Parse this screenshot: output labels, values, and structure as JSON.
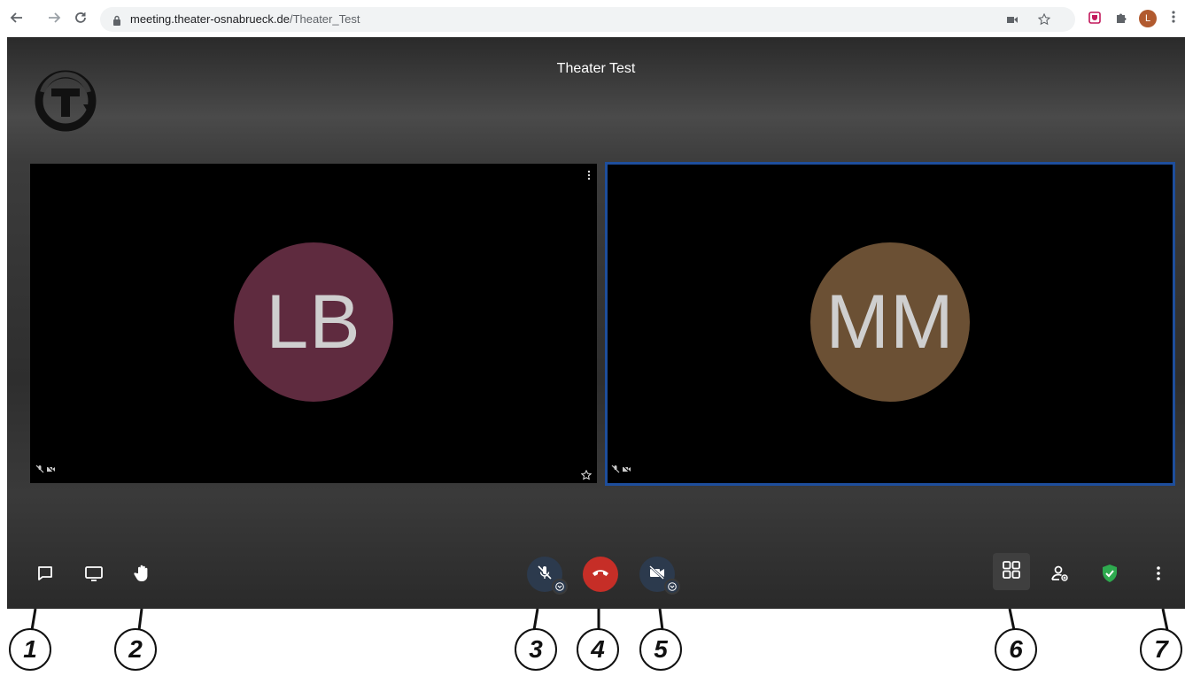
{
  "browser": {
    "url_domain": "meeting.theater-osnabrueck.de",
    "url_path": "/Theater_Test",
    "profile_initial": "L",
    "icons": [
      "back-arrow-icon",
      "forward-arrow-icon",
      "reload-icon",
      "lock-icon",
      "camera-icon",
      "star-icon",
      "extension-shield-icon",
      "puzzle-icon",
      "profile-avatar",
      "kebab-menu-icon"
    ]
  },
  "meeting": {
    "title": "Theater Test",
    "participants": [
      {
        "initials": "LB",
        "avatar_color": "#5f2b3f",
        "muted": true,
        "camera_off": true
      },
      {
        "initials": "MM",
        "avatar_color": "#6b5034",
        "muted": true,
        "camera_off": true,
        "active_speaker": true
      }
    ],
    "toolbar": {
      "left": [
        "chat-icon",
        "screenshare-icon",
        "raise-hand-icon"
      ],
      "center": [
        "microphone-muted-icon",
        "hangup-icon",
        "camera-off-icon"
      ],
      "right": [
        "tile-view-icon",
        "participants-icon",
        "security-shield-icon",
        "more-options-icon"
      ]
    },
    "colors": {
      "hangup": "#c62e27",
      "control_bg": "#2c3a4d",
      "active_border": "#1e4e9c",
      "security": "#2eaa4f"
    }
  },
  "callouts": [
    "1",
    "2",
    "3",
    "4",
    "5",
    "6",
    "7"
  ]
}
